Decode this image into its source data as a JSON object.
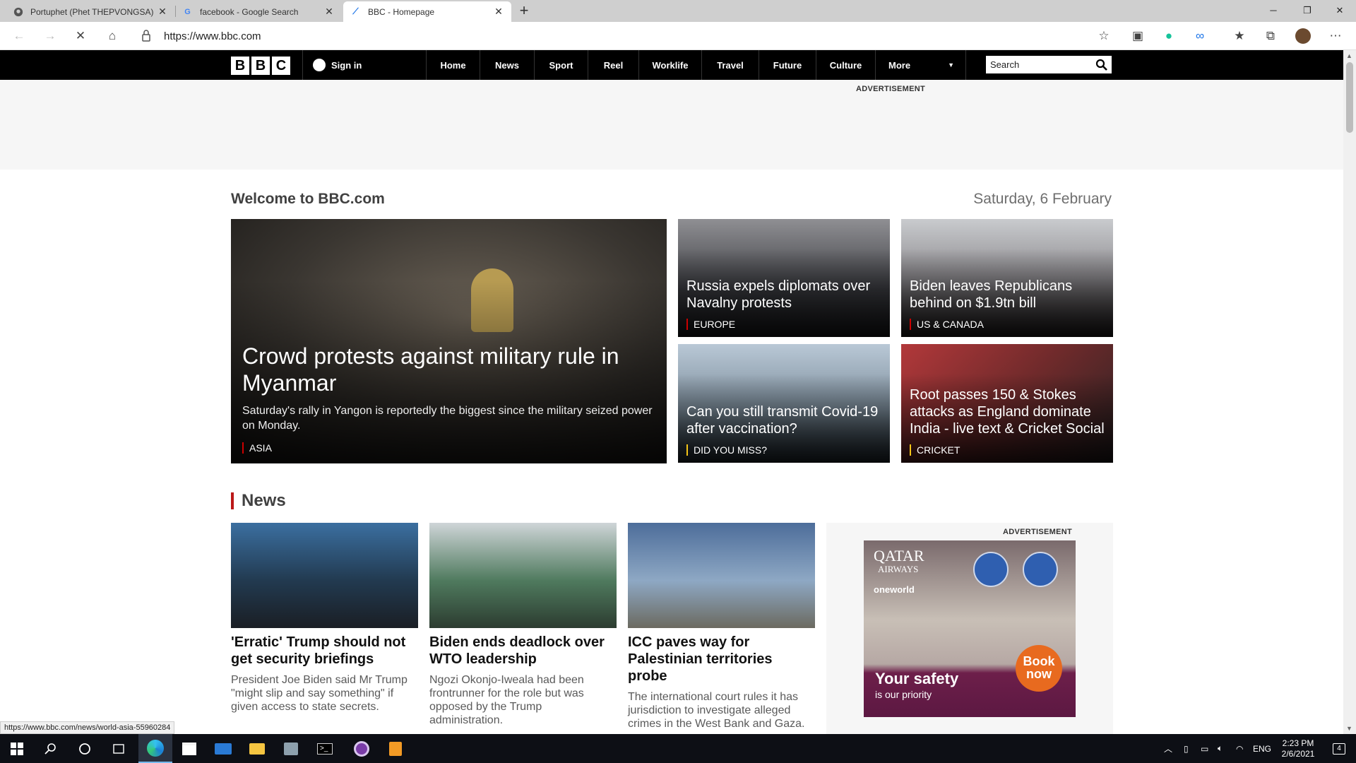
{
  "browser": {
    "tabs": [
      {
        "title": "Portuphet (Phet THEPVONGSA)",
        "icon": "github-icon"
      },
      {
        "title": "facebook - Google Search",
        "icon": "google-icon"
      },
      {
        "title": "BBC - Homepage",
        "icon": "bbc-icon"
      }
    ],
    "url": "https://www.bbc.com",
    "status_url": "https://www.bbc.com/news/world-asia-55960284"
  },
  "bbc": {
    "logo": [
      "B",
      "B",
      "C"
    ],
    "sign_in": "Sign in",
    "nav": [
      "Home",
      "News",
      "Sport",
      "Reel",
      "Worklife",
      "Travel",
      "Future",
      "Culture",
      "More"
    ],
    "search_placeholder": "Search",
    "advertisement_label": "ADVERTISEMENT",
    "welcome": "Welcome to BBC.com",
    "date": "Saturday, 6 February",
    "hero": {
      "title": "Crowd protests against military rule in Myanmar",
      "summary": "Saturday's rally in Yangon is reportedly the biggest since the military seized power on Monday.",
      "tag": "ASIA"
    },
    "top_stories": [
      {
        "title": "Russia expels diplomats over Navalny protests",
        "tag": "EUROPE"
      },
      {
        "title": "Biden leaves Republicans behind on $1.9tn bill",
        "tag": "US & CANADA"
      },
      {
        "title": "Can you still transmit Covid-19 after vaccination?",
        "tag": "DID YOU MISS?"
      },
      {
        "title": "Root passes 150 & Stokes attacks as England dominate India - live text & Cricket Social",
        "tag": "CRICKET"
      }
    ],
    "news_heading": "News",
    "news": [
      {
        "title": "'Erratic' Trump should not get security briefings",
        "summary": "President Joe Biden said Mr Trump \"might slip and say something\" if given access to state secrets."
      },
      {
        "title": "Biden ends deadlock over WTO leadership",
        "summary": "Ngozi Okonjo-Iweala had been frontrunner for the role but was opposed by the Trump administration."
      },
      {
        "title": "ICC paves way for Palestinian territories probe",
        "summary": "The international court rules it has jurisdiction to investigate alleged crimes in the West Bank and Gaza."
      }
    ],
    "ad": {
      "brand": "QATAR",
      "brand_sub": "AIRWAYS",
      "alliance": "oneworld",
      "headline": "Your safety",
      "subline": "is our priority",
      "cta": "Book now"
    }
  },
  "taskbar": {
    "language": "ENG",
    "time": "2:23 PM",
    "date": "2/6/2021",
    "notifications": "4"
  }
}
